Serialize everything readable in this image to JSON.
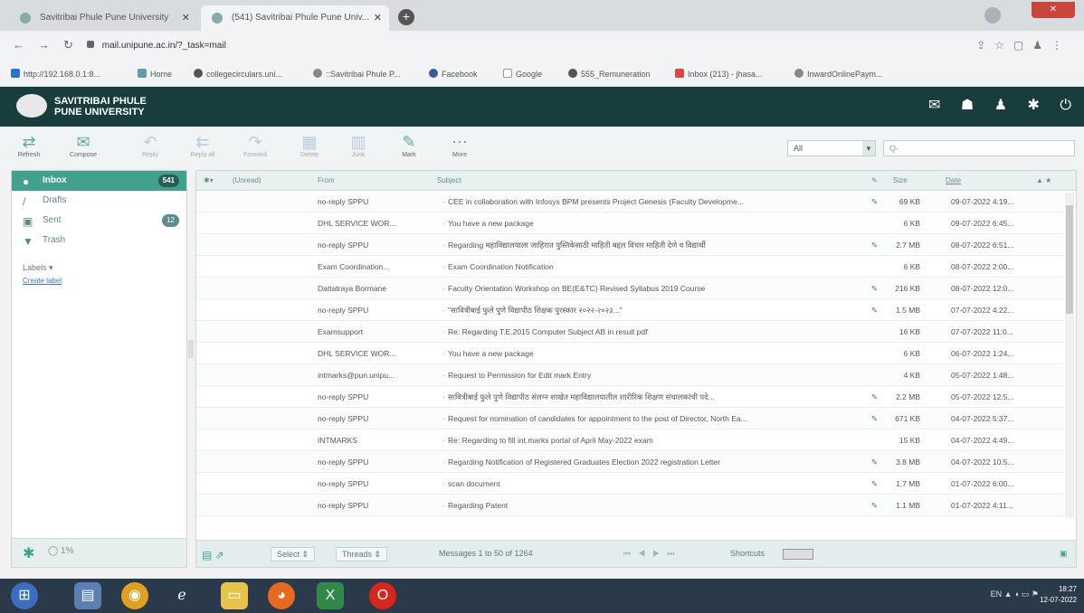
{
  "browser": {
    "tabs": [
      {
        "title": "Savitribai Phule Pune University"
      },
      {
        "title": "(541) Savitribai Phule Pune Univ..."
      }
    ],
    "url": "mail.unipune.ac.in/?_task=mail",
    "bookmarks": [
      {
        "label": "http://192.168.0.1:8..."
      },
      {
        "label": "Home"
      },
      {
        "label": "collegecirculars.uni..."
      },
      {
        "label": "::Savitribai Phule P..."
      },
      {
        "label": "Facebook"
      },
      {
        "label": "Google"
      },
      {
        "label": "555_Remuneration"
      },
      {
        "label": "Inbox (213) - jhasa..."
      },
      {
        "label": "InwardOnlinePaym..."
      }
    ]
  },
  "header": {
    "brand_line1": "SAVITRIBAI PHULE",
    "brand_line2": "PUNE UNIVERSITY"
  },
  "toolbar": {
    "buttons": [
      {
        "label": "Refresh"
      },
      {
        "label": "Compose"
      },
      {
        "label": "Reply"
      },
      {
        "label": "Reply all"
      },
      {
        "label": "Forward"
      },
      {
        "label": "Delete"
      },
      {
        "label": "Junk"
      },
      {
        "label": "Mark"
      },
      {
        "label": "More"
      }
    ],
    "filter_value": "All",
    "search_placeholder": "Q-"
  },
  "folders": [
    {
      "name": "Inbox",
      "count": "541",
      "icon": "inbox-icon"
    },
    {
      "name": "Drafts",
      "count": "",
      "icon": "pencil-icon"
    },
    {
      "name": "Sent",
      "count": "12",
      "icon": "sent-icon"
    },
    {
      "name": "Trash",
      "count": "",
      "icon": "trash-icon"
    }
  ],
  "labels": {
    "title": "Labels",
    "create": "Create label"
  },
  "sidebar_footer": {
    "quota": "1%"
  },
  "list_header": {
    "thread": "(Unread)",
    "from": "From",
    "subject": "Subject",
    "size": "Size",
    "date": "Date"
  },
  "messages": [
    {
      "from": "no-reply SPPU",
      "subject": "CEE in collaboration with Infosys BPM presents Project Genesis (Faculty Developme...",
      "attachment": true,
      "size": "69 KB",
      "date": "09-07-2022 4:19..."
    },
    {
      "from": "DHL SERVICE WOR...",
      "subject": "You have a new package",
      "attachment": false,
      "size": "6 KB",
      "date": "09-07-2022 6:45..."
    },
    {
      "from": "no-reply SPPU",
      "subject": "Regarding महाविद्यालयाला जाहिरात पुस्तिकेसाठी माहिती बद्दल विचार माहिती देणे व विद्यार्थी",
      "attachment": true,
      "size": "2.7 MB",
      "date": "08-07-2022 6:51..."
    },
    {
      "from": "Exam Coordination...",
      "subject": "Exam Coordination Notification",
      "attachment": false,
      "size": "6 KB",
      "date": "08-07-2022 2:00..."
    },
    {
      "from": "Dattatraya Bormane",
      "subject": "Faculty Orientation Workshop on BE(E&TC) Revised Syllabus 2019 Course",
      "attachment": true,
      "size": "216 KB",
      "date": "08-07-2022 12:0..."
    },
    {
      "from": "no-reply SPPU",
      "subject": "\"सावित्रीबाई फुले पुणे विद्यापीठ शिक्षक पुरस्कार २०२२-२०२३...\"",
      "attachment": true,
      "size": "1.5 MB",
      "date": "07-07-2022 4:22..."
    },
    {
      "from": "Examsupport",
      "subject": "Re: Regarding T.E.2015 Computer Subject AB in result pdf",
      "attachment": false,
      "size": "16 KB",
      "date": "07-07-2022 11:0..."
    },
    {
      "from": "DHL SERVICE WOR...",
      "subject": "You have a new package",
      "attachment": false,
      "size": "6 KB",
      "date": "06-07-2022 1:24..."
    },
    {
      "from": "intmarks@pun.unipu...",
      "subject": "Request to Permission for Edit mark Entry",
      "attachment": false,
      "size": "4 KB",
      "date": "05-07-2022 1:48..."
    },
    {
      "from": "no-reply SPPU",
      "subject": "सावित्रीबाई फुले पुणे विद्यापीठ संलग्न शाखेत महाविद्यालयातील शारीरिक शिक्षण संचालकांची पदे...",
      "attachment": true,
      "size": "2.2 MB",
      "date": "05-07-2022 12:5..."
    },
    {
      "from": "no-reply SPPU",
      "subject": "Request for nomination of candidates for appointment to the post of Director, North Ea...",
      "attachment": true,
      "size": "671 KB",
      "date": "04-07-2022 5:37..."
    },
    {
      "from": "INTMARKS",
      "subject": "Re: Regarding to fill int.marks portal of April May-2022 exam",
      "attachment": false,
      "size": "15 KB",
      "date": "04-07-2022 4:49..."
    },
    {
      "from": "no-reply SPPU",
      "subject": "Regarding Notification of Registered Graduates Election 2022 registration Letter",
      "attachment": true,
      "size": "3.8 MB",
      "date": "04-07-2022 10:5..."
    },
    {
      "from": "no-reply SPPU",
      "subject": "scan document",
      "attachment": true,
      "size": "1.7 MB",
      "date": "01-07-2022 6:00..."
    },
    {
      "from": "no-reply SPPU",
      "subject": "Regarding Patent",
      "attachment": true,
      "size": "1.1 MB",
      "date": "01-07-2022 4:11..."
    }
  ],
  "list_footer": {
    "select": "Select",
    "threads": "Threads",
    "count_text": "Messages 1 to 50 of 1264",
    "shortcuts": "Shortcuts"
  },
  "taskbar": {
    "lang": "EN",
    "time": "18:27",
    "date": "12-07-2022"
  }
}
